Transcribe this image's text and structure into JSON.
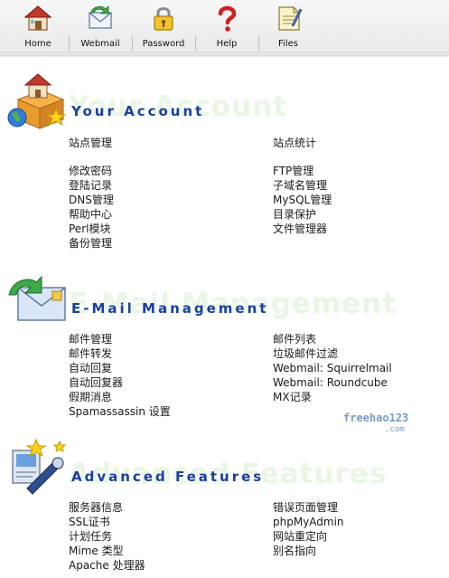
{
  "toolbar": {
    "buttons": [
      {
        "label": "Home",
        "icon": "house-icon"
      },
      {
        "label": "Webmail",
        "icon": "envelope-arrow-icon"
      },
      {
        "label": "Password",
        "icon": "padlock-icon"
      },
      {
        "label": "Help",
        "icon": "question-mark-icon"
      },
      {
        "label": "Files",
        "icon": "document-icon"
      }
    ]
  },
  "account": {
    "title": "Your Account",
    "ghost": "Your Account",
    "top_left": "站点管理",
    "top_right": "站点统计",
    "left": [
      "修改密码",
      "登陆记录",
      "DNS管理",
      "帮助中心",
      "Perl模块",
      "备份管理"
    ],
    "right": [
      "FTP管理",
      "子域名管理",
      "MySQL管理",
      "目录保护",
      "文件管理器"
    ]
  },
  "email": {
    "title": "E-Mail Management",
    "ghost": "E-Mail Management",
    "left": [
      "邮件管理",
      "邮件转发",
      "自动回复",
      "自动回复器",
      "假期消息",
      "Spamassassin 设置"
    ],
    "right": [
      "邮件列表",
      "垃圾邮件过滤",
      "Webmail: Squirrelmail",
      "Webmail: Roundcube",
      "MX记录"
    ]
  },
  "advanced": {
    "title": "Advanced Features",
    "ghost": "Advanced Features",
    "left": [
      "服务器信息",
      "SSL证书",
      "计划任务",
      "Mime 类型",
      "Apache 处理器"
    ],
    "right": [
      "错误页面管理",
      "phpMyAdmin",
      "网站重定向",
      "别名指向"
    ]
  },
  "watermark": {
    "line1": "freehao123",
    "line2": ".com"
  },
  "colors": {
    "title_blue": "#1a3f9e",
    "ghost_green": "#e9f6e4"
  }
}
